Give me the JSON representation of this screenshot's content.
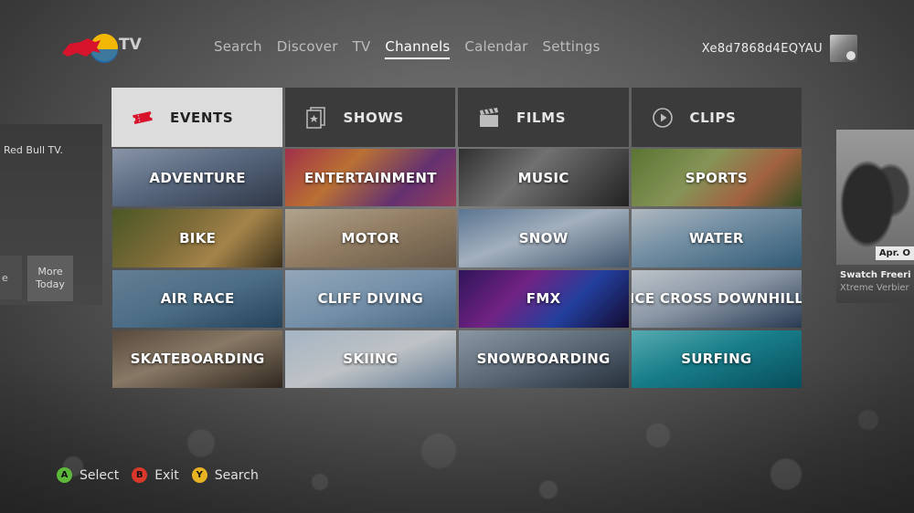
{
  "app": {
    "logo_text": "TV",
    "brand_colors": {
      "red": "#d7142b",
      "yellow": "#f2b705",
      "blue": "#1d6fb8"
    }
  },
  "nav": {
    "items": [
      {
        "label": "Search"
      },
      {
        "label": "Discover"
      },
      {
        "label": "TV"
      },
      {
        "label": "Channels",
        "active": true
      },
      {
        "label": "Calendar"
      },
      {
        "label": "Settings"
      }
    ]
  },
  "user": {
    "gamertag": "Xe8d7868d4EQYAU",
    "avatar_icon": "avatar-icon"
  },
  "left_peek": {
    "caption": "Red Bull TV.",
    "partial_label": "e",
    "more_today": [
      "More",
      "Today"
    ]
  },
  "right_peek": {
    "date": "Apr. O",
    "title": "Swatch Freeri",
    "subtitle": "Xtreme Verbier"
  },
  "tabs": [
    {
      "label": "EVENTS",
      "icon": "ticket-icon",
      "active": true
    },
    {
      "label": "SHOWS",
      "icon": "shows-icon",
      "active": false
    },
    {
      "label": "FILMS",
      "icon": "clapperboard-icon",
      "active": false
    },
    {
      "label": "CLIPS",
      "icon": "play-circle-icon",
      "active": false
    }
  ],
  "channels": [
    "ADVENTURE",
    "ENTERTAINMENT",
    "MUSIC",
    "SPORTS",
    "BIKE",
    "MOTOR",
    "SNOW",
    "WATER",
    "AIR RACE",
    "CLIFF DIVING",
    "FMX",
    "ICE CROSS DOWNHILL",
    "SKATEBOARDING",
    "SKIING",
    "SNOWBOARDING",
    "SURFING"
  ],
  "hints": [
    {
      "button": "A",
      "label": "Select",
      "color": "#5cb838"
    },
    {
      "button": "B",
      "label": "Exit",
      "color": "#d8392b"
    },
    {
      "button": "Y",
      "label": "Search",
      "color": "#e8b323"
    }
  ]
}
